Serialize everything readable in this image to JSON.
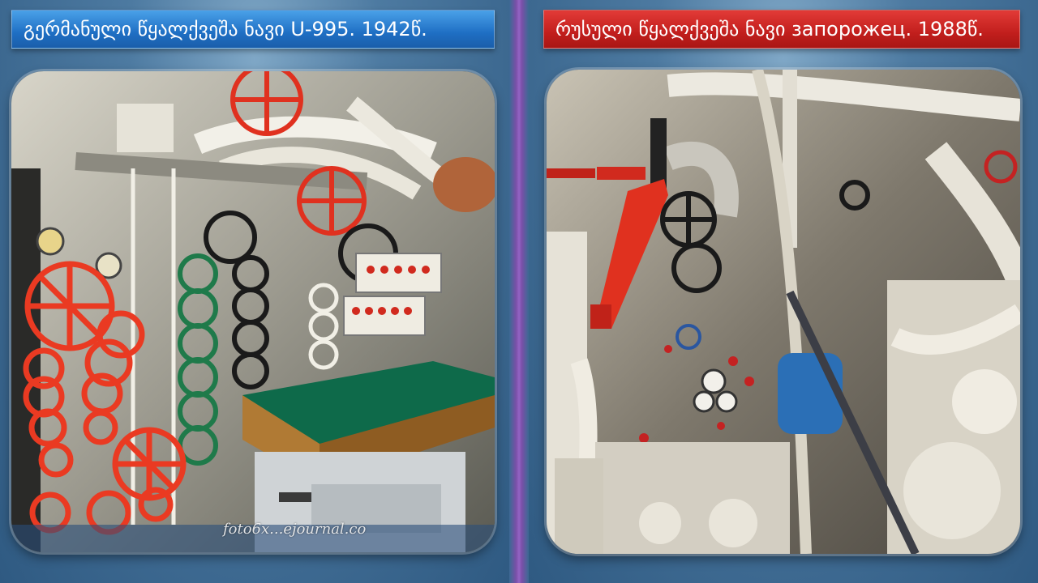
{
  "slide": {
    "left_caption": "გერმანული წყალქვეშა ნავი U-995. 1942წ.",
    "right_caption": "რუსული წყალქვეშა ნავი запорожец. 1988წ.",
    "left_photo_watermark": "foto6x...ejournal.co"
  },
  "colors": {
    "background": "#2f5a82",
    "left_caption_bg": "#1f6fc4",
    "right_caption_bg": "#c21f1d",
    "divider": "#9364c4",
    "valve_red": "#e0311f",
    "valve_green": "#1f7a4a",
    "table_top": "#0e6a4a"
  }
}
